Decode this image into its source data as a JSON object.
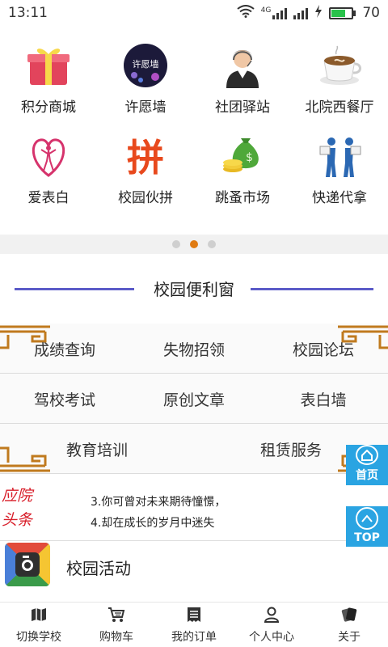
{
  "status": {
    "time": "13:11",
    "network": "4G",
    "battery": "70"
  },
  "grid": [
    {
      "label": "积分商城",
      "icon": "gift-icon"
    },
    {
      "label": "许愿墙",
      "icon": "wish-wall-icon"
    },
    {
      "label": "社团驿站",
      "icon": "person-headset-icon"
    },
    {
      "label": "北院西餐厅",
      "icon": "coffee-cup-icon"
    },
    {
      "label": "爱表白",
      "icon": "heart-figure-icon"
    },
    {
      "label": "校园伙拼",
      "icon": "pin-char-icon"
    },
    {
      "label": "跳蚤市场",
      "icon": "money-bag-icon"
    },
    {
      "label": "快递代拿",
      "icon": "courier-icon"
    }
  ],
  "wish_wall_text": "许愿墙",
  "pin_char": "拼",
  "pager": {
    "count": 3,
    "active": 1
  },
  "section_title": "校园便利窗",
  "services": {
    "row1": [
      "成绩查询",
      "失物招领",
      "校园论坛"
    ],
    "row2": [
      "驾校考试",
      "原创文章",
      "表白墙"
    ],
    "row3": [
      "教育培训",
      "租赁服务"
    ]
  },
  "headline": {
    "tag_line1": "应院",
    "tag_line2": "头条",
    "items": [
      "3.你可曾对未来期待憧憬，",
      "4.却在成长的岁月中迷失"
    ]
  },
  "activity": {
    "label": "校园活动"
  },
  "float_buttons": {
    "home": "首页",
    "top": "TOP"
  },
  "tabs": [
    {
      "label": "切换学校",
      "icon": "map-icon"
    },
    {
      "label": "购物车",
      "icon": "cart-icon"
    },
    {
      "label": "我的订单",
      "icon": "receipt-icon"
    },
    {
      "label": "个人中心",
      "icon": "user-icon"
    },
    {
      "label": "关于",
      "icon": "cards-icon"
    }
  ],
  "colors": {
    "accent": "#e07b12",
    "title_line": "#5b5bc8",
    "float": "#2aa4e2",
    "headline_tag": "#d81e2a"
  }
}
